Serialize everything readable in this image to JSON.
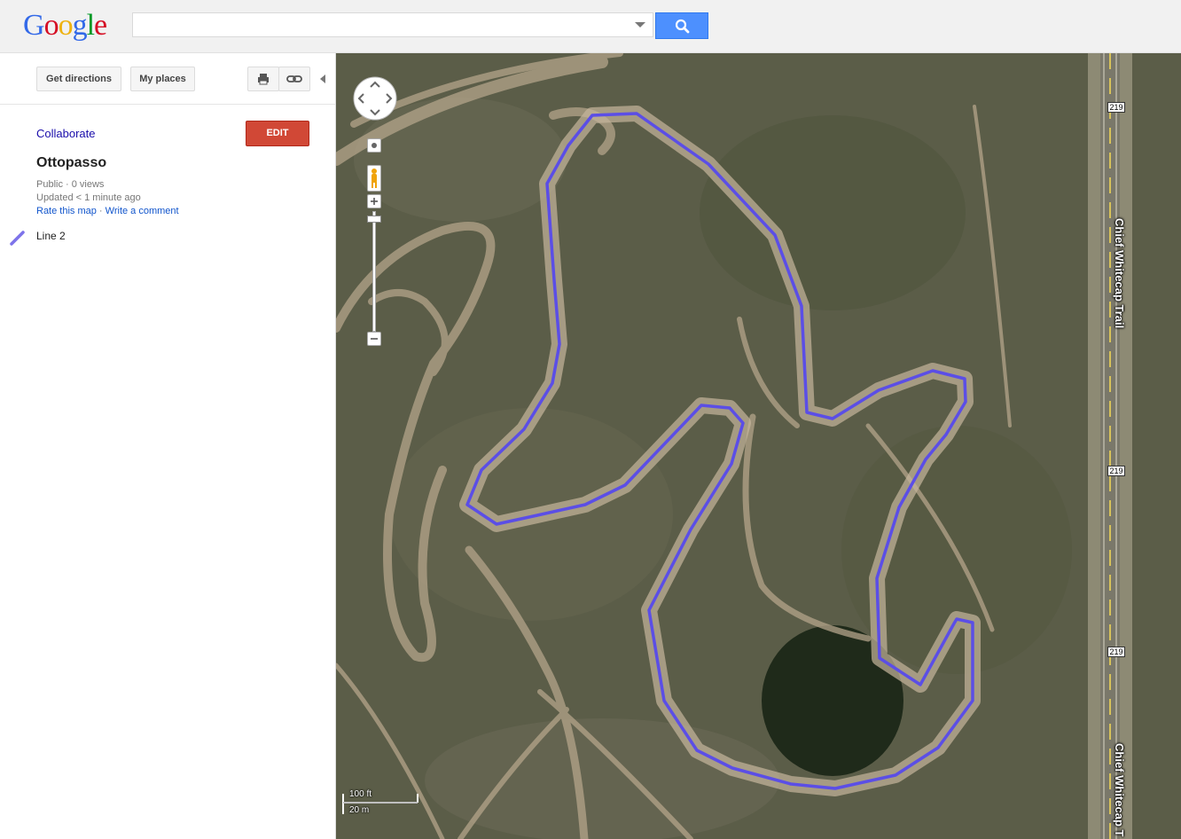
{
  "header": {
    "logo_letters": [
      {
        "ch": "G",
        "color": "#3369e8"
      },
      {
        "ch": "o",
        "color": "#d50f25"
      },
      {
        "ch": "o",
        "color": "#eeb211"
      },
      {
        "ch": "g",
        "color": "#3369e8"
      },
      {
        "ch": "l",
        "color": "#009925"
      },
      {
        "ch": "e",
        "color": "#d50f25"
      }
    ],
    "search_value": "",
    "search_icon": "search-icon"
  },
  "sidebar": {
    "get_directions_label": "Get directions",
    "my_places_label": "My places",
    "print_icon": "print-icon",
    "link_icon": "link-icon",
    "collaborate_label": "Collaborate",
    "edit_label": "EDIT",
    "map_title": "Ottopasso",
    "visibility": "Public · 0 views",
    "updated": "Updated < 1 minute ago",
    "rate_label": "Rate this map",
    "separator": " · ",
    "comment_label": "Write a comment",
    "line_item": {
      "label": "Line 2",
      "icon": "line-icon",
      "color": "#7d73ea"
    }
  },
  "map": {
    "type": "satellite",
    "route_color": "#5b4ee6",
    "scale_feet": "100 ft",
    "scale_meters": "20 m",
    "highway_shield": "219",
    "road_name": "Chief Whitecap Trail",
    "road_name_bottom": "Chief Whitecap T"
  },
  "colors": {
    "accent": "#4d90fe",
    "edit": "#d14836",
    "link": "#1155cc"
  }
}
